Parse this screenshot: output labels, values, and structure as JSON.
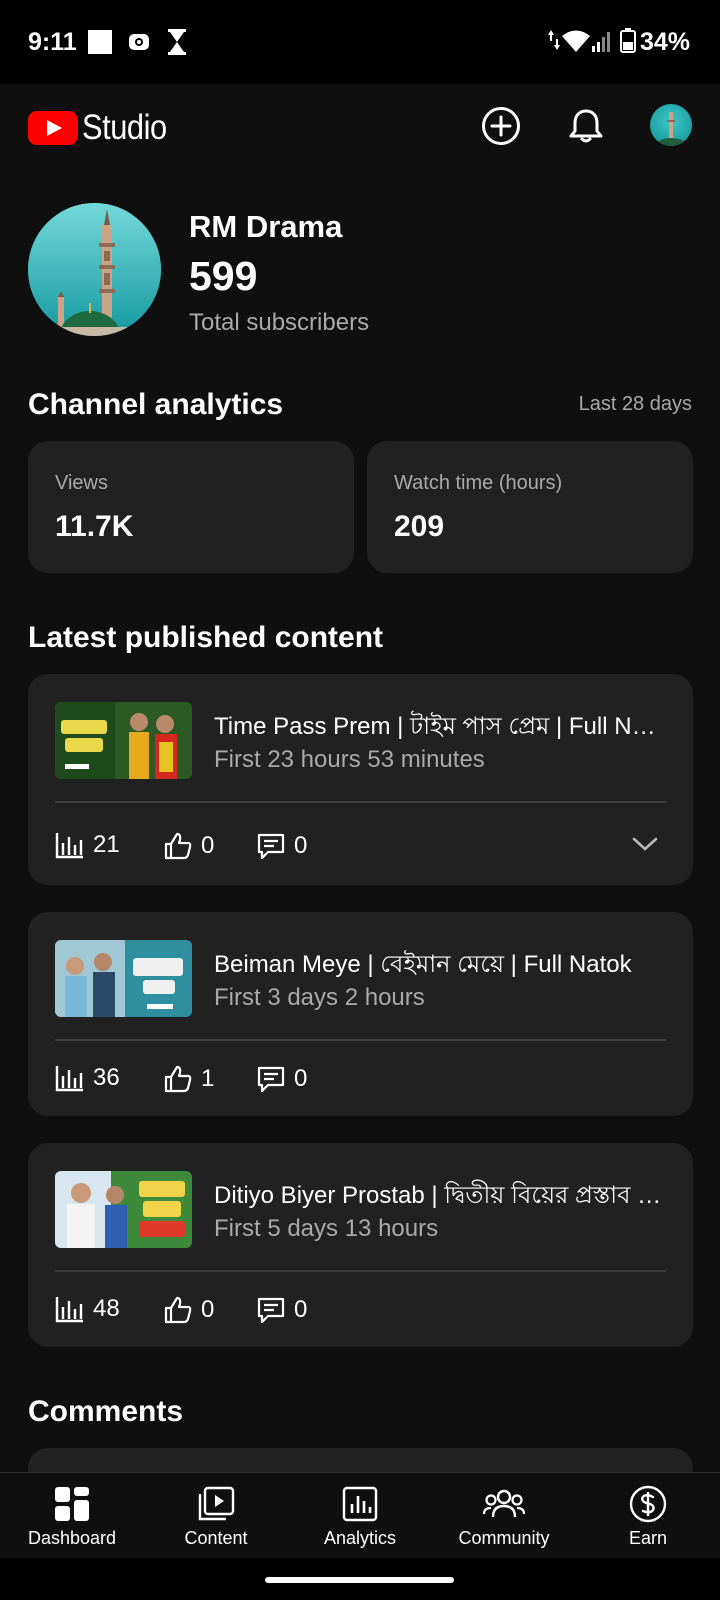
{
  "status_bar": {
    "time": "9:11",
    "battery": "34%"
  },
  "app_bar": {
    "logo_text": "Studio"
  },
  "channel": {
    "name": "RM Drama",
    "subscribers": "599",
    "subscribers_label": "Total subscribers"
  },
  "analytics": {
    "title": "Channel analytics",
    "period": "Last 28 days",
    "cards": [
      {
        "label": "Views",
        "value": "11.7K"
      },
      {
        "label": "Watch time (hours)",
        "value": "209"
      }
    ]
  },
  "latest": {
    "title": "Latest published content",
    "videos": [
      {
        "title": "Time Pass Prem | টাইম পাস প্রেম | Full Natok",
        "subtitle": "First 23 hours 53 minutes",
        "views": "21",
        "likes": "0",
        "comments": "0"
      },
      {
        "title": "Beiman Meye | বেইমান মেয়ে | Full Natok",
        "subtitle": "First 3 days 2 hours",
        "views": "36",
        "likes": "1",
        "comments": "0"
      },
      {
        "title": "Ditiyo Biyer Prostab | দ্বিতীয় বিয়ের প্রস্তাব | Full Natok",
        "subtitle": "First 5 days 13 hours",
        "views": "48",
        "likes": "0",
        "comments": "0"
      }
    ]
  },
  "comments": {
    "title": "Comments"
  },
  "bottom_nav": {
    "items": [
      {
        "label": "Dashboard",
        "icon": "dashboard-icon"
      },
      {
        "label": "Content",
        "icon": "content-icon"
      },
      {
        "label": "Analytics",
        "icon": "analytics-icon"
      },
      {
        "label": "Community",
        "icon": "community-icon"
      },
      {
        "label": "Earn",
        "icon": "earn-icon"
      }
    ]
  },
  "colors": {
    "background": "#0f0f0f",
    "card": "#212121",
    "brand_red": "#ff0000",
    "secondary_text": "#aaaaaa"
  }
}
